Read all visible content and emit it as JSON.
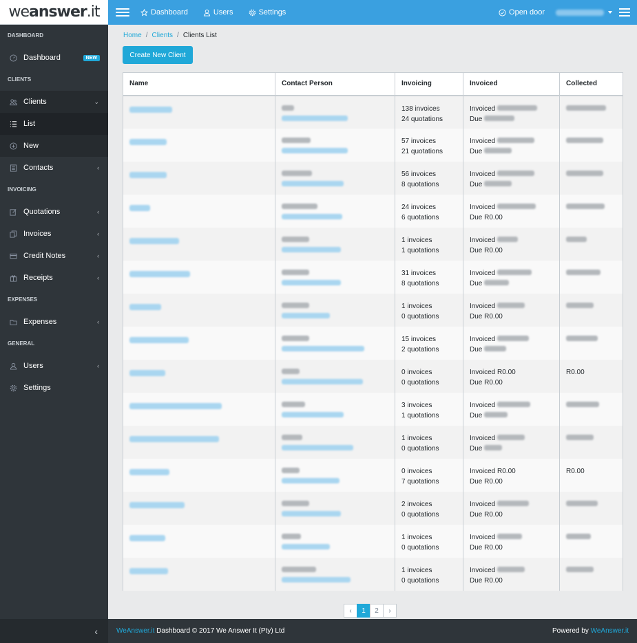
{
  "brand": {
    "part1": "we",
    "part2": "answer",
    "part3": ".it"
  },
  "topnav": {
    "items": [
      {
        "label": "Dashboard",
        "icon": "star-icon"
      },
      {
        "label": "Users",
        "icon": "user-icon"
      },
      {
        "label": "Settings",
        "icon": "gear-icon"
      }
    ],
    "open_door": "Open door"
  },
  "sidebar": {
    "sections": {
      "dashboard": "DASHBOARD",
      "clients": "CLIENTS",
      "invoicing": "INVOICING",
      "expenses": "EXPENSES",
      "general": "GENERAL"
    },
    "dashboard": {
      "label": "Dashboard",
      "badge": "NEW"
    },
    "clients": "Clients",
    "list": "List",
    "new": "New",
    "contacts": "Contacts",
    "quotations": "Quotations",
    "invoices": "Invoices",
    "credit_notes": "Credit Notes",
    "receipts": "Receipts",
    "expenses": "Expenses",
    "users": "Users",
    "settings": "Settings"
  },
  "breadcrumb": {
    "home": "Home",
    "clients": "Clients",
    "current": "Clients List"
  },
  "create_button": "Create New Client",
  "table": {
    "headers": [
      "Name",
      "Contact Person",
      "Invoicing",
      "Invoiced",
      "Collected"
    ],
    "rows": [
      {
        "invoices": "138 invoices",
        "quotations": "24 quotations",
        "invoiced_label": "Invoiced",
        "due_label": "Due",
        "due_value": "",
        "collected": ""
      },
      {
        "invoices": "57 invoices",
        "quotations": "21 quotations",
        "invoiced_label": "Invoiced",
        "due_label": "Due",
        "due_value": "",
        "collected": ""
      },
      {
        "invoices": "56 invoices",
        "quotations": "8 quotations",
        "invoiced_label": "Invoiced",
        "due_label": "Due",
        "due_value": "",
        "collected": ""
      },
      {
        "invoices": "24 invoices",
        "quotations": "6 quotations",
        "invoiced_label": "Invoiced",
        "due_label": "Due",
        "due_value": "R0.00",
        "collected": ""
      },
      {
        "invoices": "1 invoices",
        "quotations": "1 quotations",
        "invoiced_label": "Invoiced",
        "due_label": "Due",
        "due_value": "R0.00",
        "collected": ""
      },
      {
        "invoices": "31 invoices",
        "quotations": "8 quotations",
        "invoiced_label": "Invoiced",
        "due_label": "Due",
        "due_value": "",
        "collected": ""
      },
      {
        "invoices": "1 invoices",
        "quotations": "0 quotations",
        "invoiced_label": "Invoiced",
        "due_label": "Due",
        "due_value": "R0.00",
        "collected": ""
      },
      {
        "invoices": "15 invoices",
        "quotations": "2 quotations",
        "invoiced_label": "Invoiced",
        "due_label": "Due",
        "due_value": "",
        "collected": ""
      },
      {
        "invoices": "0 invoices",
        "quotations": "0 quotations",
        "invoiced_label": "Invoiced R0.00",
        "due_label": "Due",
        "due_value": "R0.00",
        "collected": "R0.00"
      },
      {
        "invoices": "3 invoices",
        "quotations": "1 quotations",
        "invoiced_label": "Invoiced",
        "due_label": "Due",
        "due_value": "",
        "collected": ""
      },
      {
        "invoices": "1 invoices",
        "quotations": "0 quotations",
        "invoiced_label": "Invoiced",
        "due_label": "Due",
        "due_value": "",
        "collected": ""
      },
      {
        "invoices": "0 invoices",
        "quotations": "7 quotations",
        "invoiced_label": "Invoiced R0.00",
        "due_label": "Due",
        "due_value": "R0.00",
        "collected": "R0.00"
      },
      {
        "invoices": "2 invoices",
        "quotations": "0 quotations",
        "invoiced_label": "Invoiced",
        "due_label": "Due",
        "due_value": "R0.00",
        "collected": ""
      },
      {
        "invoices": "1 invoices",
        "quotations": "0 quotations",
        "invoiced_label": "Invoiced",
        "due_label": "Due",
        "due_value": "R0.00",
        "collected": ""
      },
      {
        "invoices": "1 invoices",
        "quotations": "0 quotations",
        "invoiced_label": "Invoiced",
        "due_label": "Due",
        "due_value": "R0.00",
        "collected": ""
      }
    ]
  },
  "pagination": {
    "prev": "‹",
    "pages": [
      "1",
      "2"
    ],
    "next": "›"
  },
  "footer": {
    "brand_link": "WeAnswer.it",
    "text": "Dashboard © 2017 We Answer It (Pty) Ltd",
    "powered": "Powered by",
    "powered_link": "WeAnswer.it"
  },
  "colors": {
    "primary": "#20a8d8",
    "topbar": "#3aa0e0",
    "sidebar": "#2f353a"
  }
}
